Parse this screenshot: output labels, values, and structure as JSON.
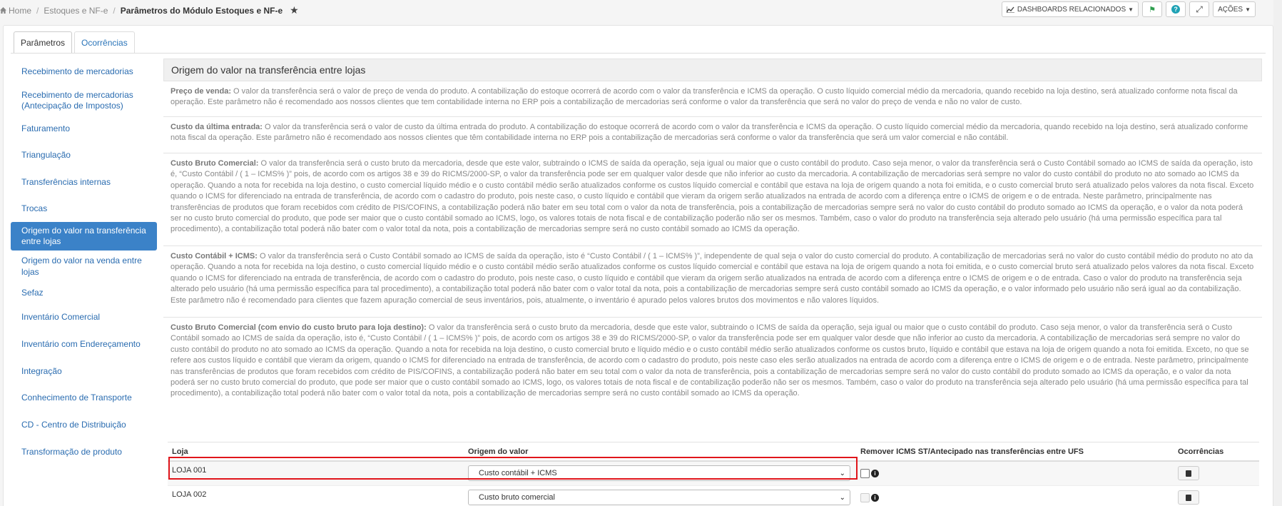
{
  "breadcrumb": {
    "home": "Home",
    "module": "Estoques e NF-e",
    "current": "Parâmetros do Módulo Estoques e NF-e"
  },
  "toolbar": {
    "dashboards": "DASHBOARDS RELACIONADOS",
    "actions": "AÇÕES"
  },
  "tabs": [
    {
      "label": "Parâmetros",
      "active": true
    },
    {
      "label": "Ocorrências",
      "active": false
    }
  ],
  "sidebar": {
    "items": [
      {
        "label": "Recebimento de mercadorias"
      },
      {
        "label": "Recebimento de mercadorias (Antecipação de Impostos)"
      },
      {
        "label": "Faturamento"
      },
      {
        "label": "Triangulação"
      },
      {
        "label": "Transferências internas"
      },
      {
        "label": "Trocas"
      },
      {
        "label": "Origem do valor na transferência entre lojas",
        "active": true
      },
      {
        "label": "Origem do valor na venda entre lojas"
      },
      {
        "label": "Sefaz"
      },
      {
        "label": "Inventário Comercial"
      },
      {
        "label": "Inventário com Endereçamento"
      },
      {
        "label": "Integração"
      },
      {
        "label": "Conhecimento de Transporte"
      },
      {
        "label": "CD - Centro de Distribuição"
      },
      {
        "label": "Transformação de produto"
      }
    ]
  },
  "content": {
    "title": "Origem do valor na transferência entre lojas",
    "sections": [
      {
        "heading": "Preço de venda:",
        "text": " O valor da transferência será o valor de preço de venda do produto. A contabilização do estoque ocorrerá de acordo com o valor da transferência e ICMS da operação. O custo líquido comercial médio da mercadoria, quando recebido na loja destino, será atualizado conforme nota fiscal da operação. Este parâmetro não é recomendado aos nossos clientes que tem contabilidade interna no ERP pois a contabilização de mercadorias será conforme o valor da transferência que será no valor do preço de venda e não no valor de custo."
      },
      {
        "heading": "Custo da última entrada:",
        "text": " O valor da transferência será o valor de custo da última entrada do produto. A contabilização do estoque ocorrerá de acordo com o valor da transferência e ICMS da operação. O custo líquido comercial médio da mercadoria, quando recebido na loja destino, será atualizado conforme nota fiscal da operação. Este parâmetro não é recomendado aos nossos clientes que têm contabilidade interna no ERP pois a contabilização de mercadorias será conforme o valor da transferência que será um valor comercial e não contábil."
      },
      {
        "heading": "Custo Bruto Comercial:",
        "text": " O valor da transferência será o custo bruto da mercadoria, desde que este valor, subtraindo o ICMS de saída da operação, seja igual ou maior que o custo contábil do produto. Caso seja menor, o valor da transferência será o Custo Contábil somado ao ICMS de saída da operação, isto é, “Custo Contábil / ( 1 – ICMS% )” pois, de acordo com os artigos 38 e 39 do RICMS/2000-SP, o valor da transferência pode ser em qualquer valor desde que não inferior ao custo da mercadoria. A contabilização de mercadorias será sempre no valor do custo contábil do produto no ato somado ao ICMS da operação. Quando a nota for recebida na loja destino, o custo comercial líquido médio e o custo contábil médio serão atualizados conforme os custos líquido comercial e contábil que estava na loja de origem quando a nota foi emitida, e o custo comercial bruto será atualizado pelos valores da nota fiscal. Exceto quando o ICMS for diferenciado na entrada de transferência, de acordo com o cadastro do produto, pois neste caso, o custo líquido e contábil que vieram da origem serão atualizados na entrada de acordo com a diferença entre o ICMS de origem e o de entrada. Neste parâmetro, principalmente nas transferências de produtos que foram recebidos com crédito de PIS/COFINS, a contabilização poderá não bater em seu total com o valor da nota de transferência, pois a contabilização de mercadorias sempre será no valor do custo contábil do produto somado ao ICMS da operação, e o valor da nota poderá ser no custo bruto comercial do produto, que pode ser maior que o custo contábil somado ao ICMS, logo, os valores totais de nota fiscal e de contabilização poderão não ser os mesmos. Também, caso o valor do produto na transferência seja alterado pelo usuário (há uma permissão específica para tal procedimento), a contabilização total poderá não bater com o valor total da nota, pois a contabilização de mercadorias sempre será no custo contábil somado ao ICMS da operação."
      },
      {
        "heading": "Custo Contábil + ICMS:",
        "text": " O valor da transferência será o Custo Contábil somado ao ICMS de saída da operação, isto é “Custo Contábil / ( 1 – ICMS% )”, independente de qual seja o valor do custo comercial do produto. A contabilização de mercadorias será no valor do custo contábil médio do produto no ato da operação. Quando a nota for recebida na loja destino, o custo comercial líquido médio e o custo contábil médio serão atualizados conforme os custos líquido comercial e contábil que estava na loja de origem quando a nota foi emitida, e o custo comercial bruto será atualizado pelos valores da nota fiscal. Exceto quando o ICMS for diferenciado na entrada de transferência, de acordo com o cadastro do produto, pois neste caso, o custo líquido e contábil que vieram da origem serão atualizados na entrada de acordo com a diferença entre o ICMS de origem e o de entrada. Caso o valor do produto na transferência seja alterado pelo usuário (há uma permissão específica para tal procedimento), a contabilização total poderá não bater com o valor total da nota, pois a contabilização de mercadorias sempre será custo contábil somado ao ICMS da operação, e o valor informado pelo usuário não será igual ao da contabilização. Este parâmetro não é recomendado para clientes que fazem apuração comercial de seus inventários, pois, atualmente, o inventário é apurado pelos valores brutos dos movimentos e não valores líquidos."
      },
      {
        "heading": "Custo Bruto Comercial (com envio do custo bruto para loja destino):",
        "text": " O valor da transferência será o custo bruto da mercadoria, desde que este valor, subtraindo o ICMS de saída da operação, seja igual ou maior que o custo contábil do produto. Caso seja menor, o valor da transferência será o Custo Contábil somado ao ICMS de saída da operação, isto é, “Custo Contábil / ( 1 – ICMS% )” pois, de acordo com os artigos 38 e 39 do RICMS/2000-SP, o valor da transferência pode ser em qualquer valor desde que não inferior ao custo da mercadoria. A contabilização de mercadorias será sempre no valor do custo contábil do produto no ato somado ao ICMS da operação. Quando a nota for recebida na loja destino, o custo comercial bruto e líquido médio e o custo contábil médio serão atualizados conforme os custos bruto, líquido e contábil que estava na loja de origem quando a nota foi emitida. Exceto, no que se refere aos custos líquido e contábil que vieram da origem, quando o ICMS for diferenciado na entrada de transferência, de acordo com o cadastro do produto, pois neste caso eles serão atualizados na entrada de acordo com a diferença entre o ICMS de origem e o de entrada. Neste parâmetro, principalmente nas transferências de produtos que foram recebidos com crédito de PIS/COFINS, a contabilização poderá não bater em seu total com o valor da nota de transferência, pois a contabilização de mercadorias sempre será no valor do custo contábil do produto somado ao ICMS da operação, e o valor da nota poderá ser no custo bruto comercial do produto, que pode ser maior que o custo contábil somado ao ICMS, logo, os valores totais de nota fiscal e de contabilização poderão não ser os mesmos. Também, caso o valor do produto na transferência seja alterado pelo usuário (há uma permissão específica para tal procedimento), a contabilização total poderá não bater com o valor total da nota, pois a contabilização de mercadorias sempre será no custo contábil somado ao ICMS da operação."
      }
    ]
  },
  "table": {
    "headers": [
      "Loja",
      "Origem do valor",
      "Remover ICMS ST/Antecipado nas transferências entre UFS",
      "Ocorrências"
    ],
    "rows": [
      {
        "loja": "LOJA 001",
        "origem": "Custo contábil + ICMS",
        "remover_checked": false
      },
      {
        "loja": "LOJA 002",
        "origem": "Custo bruto comercial",
        "remover_checked": false
      }
    ]
  },
  "colors": {
    "accent": "#3b82c8",
    "highlight": "#e0151b",
    "link": "#2a6cb0"
  }
}
